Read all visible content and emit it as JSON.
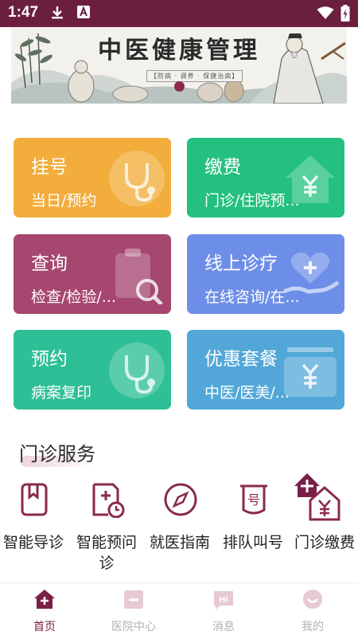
{
  "status_bar": {
    "time": "1:47"
  },
  "banner": {
    "title": "中医健康管理",
    "subtitle": "【防病 · 调养 · 保健治病】"
  },
  "cards": [
    {
      "title": "挂号",
      "subtitle": "当日/预约",
      "color": "#f2ad3c",
      "icon": "stethoscope-icon"
    },
    {
      "title": "缴费",
      "subtitle": "门诊/住院预...",
      "color": "#23c07f",
      "icon": "house-yen-icon"
    },
    {
      "title": "查询",
      "subtitle": "检查/检验/...",
      "color": "#a64770",
      "icon": "clipboard-search-icon"
    },
    {
      "title": "线上诊疗",
      "subtitle": "在线咨询/在...",
      "color": "#6d8ee8",
      "icon": "heart-hand-icon"
    },
    {
      "title": "预约",
      "subtitle": "病案复印",
      "color": "#2ebf96",
      "icon": "stethoscope-icon"
    },
    {
      "title": "优惠套餐",
      "subtitle": "中医/医美/...",
      "color": "#52a7d8",
      "icon": "yen-box-icon"
    }
  ],
  "outpatient": {
    "title": "门诊服务",
    "items": [
      {
        "label": "智能导诊",
        "icon": "bookmark-icon"
      },
      {
        "label": "智能预问诊",
        "icon": "document-clock-icon"
      },
      {
        "label": "就医指南",
        "icon": "compass-icon"
      },
      {
        "label": "排队叫号",
        "icon": "number-ticket-icon"
      },
      {
        "label": "门诊缴费",
        "icon": "house-yen-icon"
      }
    ]
  },
  "tabbar": {
    "items": [
      {
        "label": "首页",
        "icon": "home-icon",
        "active": true
      },
      {
        "label": "医院中心",
        "icon": "hospital-icon",
        "active": false
      },
      {
        "label": "消息",
        "icon": "message-icon",
        "active": false
      },
      {
        "label": "我的",
        "icon": "profile-icon",
        "active": false
      }
    ]
  },
  "colors": {
    "brand": "#6b1f3f",
    "active_tab": "#7a1f46",
    "inactive_tab": "#b0b0b0"
  }
}
